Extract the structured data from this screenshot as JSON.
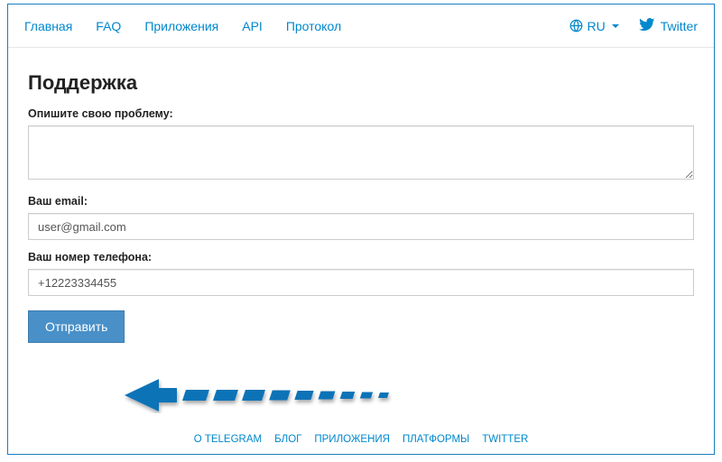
{
  "nav": {
    "items": [
      "Главная",
      "FAQ",
      "Приложения",
      "API",
      "Протокол"
    ],
    "lang_label": "RU",
    "twitter_label": "Twitter"
  },
  "page": {
    "title": "Поддержка",
    "problem_label": "Опишите свою проблему:",
    "problem_value": "",
    "email_label": "Ваш email:",
    "email_value": "user@gmail.com",
    "phone_label": "Ваш номер телефона:",
    "phone_value": "+12223334455",
    "submit_label": "Отправить"
  },
  "footer": {
    "items": [
      "О TELEGRAM",
      "БЛОГ",
      "ПРИЛОЖЕНИЯ",
      "ПЛАТФОРМЫ",
      "TWITTER"
    ]
  },
  "colors": {
    "link": "#0088cc",
    "button_bg": "#4990c8",
    "arrow": "#0d73b7"
  }
}
